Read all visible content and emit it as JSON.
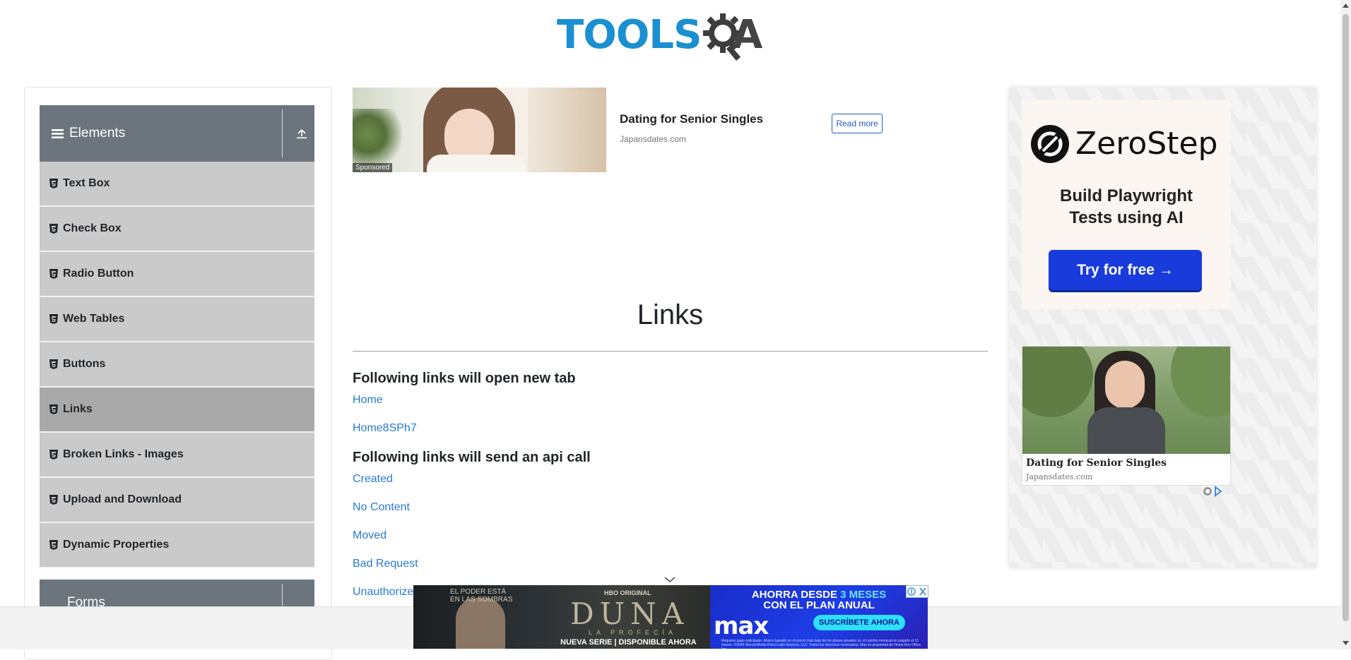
{
  "header": {
    "logo_text_left": "TOOLS",
    "logo_text_right": "A",
    "logo_icon": "magnifier-gear-icon"
  },
  "sidebar": {
    "group": {
      "label": "Elements",
      "icon": "hamburger-icon",
      "toggle_icon": "upload-icon"
    },
    "items": [
      {
        "label": "Text Box"
      },
      {
        "label": "Check Box"
      },
      {
        "label": "Radio Button"
      },
      {
        "label": "Web Tables"
      },
      {
        "label": "Buttons"
      },
      {
        "label": "Links",
        "active": true
      },
      {
        "label": "Broken Links - Images"
      },
      {
        "label": "Upload and Download"
      },
      {
        "label": "Dynamic Properties"
      }
    ],
    "next_group": {
      "label": "Forms"
    }
  },
  "top_ad": {
    "badge": "Sponsored",
    "title": "Dating for Senior Singles",
    "domain": "Japansdates.com",
    "button": "Read more"
  },
  "main": {
    "title": "Links",
    "section_new_tab": "Following links will open new tab",
    "new_tab_links": [
      "Home",
      "Home8SPh7"
    ],
    "section_api": "Following links will send an api call",
    "api_links": [
      "Created",
      "No Content",
      "Moved",
      "Bad Request",
      "Unauthorized"
    ]
  },
  "right_ad": {
    "brand": "ZeroStep",
    "tagline_line1": "Build Playwright",
    "tagline_line2": "Tests using AI",
    "cta": "Try for free →",
    "ad2_title": "Dating for Senior Singles",
    "ad2_domain": "Japansdates.com"
  },
  "banner": {
    "top_small_1": "EL PODER ESTÁ",
    "top_small_2": "EN LAS SOMBRAS",
    "network": "HBO ORIGINAL",
    "show": "DUNA",
    "subtitle": "LA PROFECÍA",
    "tagline": "NUEVA SERIE | DISPONIBLE AHORA",
    "promo_1": "AHORRA DESDE",
    "promo_highlight": "3 MESES",
    "promo_2": "CON EL PLAN ANUAL",
    "brand": "max",
    "cta": "SUSCRÍBETE AHORA",
    "fine_print": "Requiere pago anticipado. Ahorro basado en el precio más bajo de los planes anuales vs. el cambio mensual en pagado el 12 meses. ©2024 WarnerMedia Direct Latin America, LLC. Todos los derechos reservados. Max es propiedad de Home Box Office, Inc."
  },
  "colors": {
    "link": "#2a7ad2",
    "sidebar_header": "#6c757d",
    "sidebar_item": "#cacaca",
    "sidebar_active": "#a9a9a9",
    "logo_blue": "#1a8fd1",
    "cta_blue": "#1a3bdb"
  }
}
